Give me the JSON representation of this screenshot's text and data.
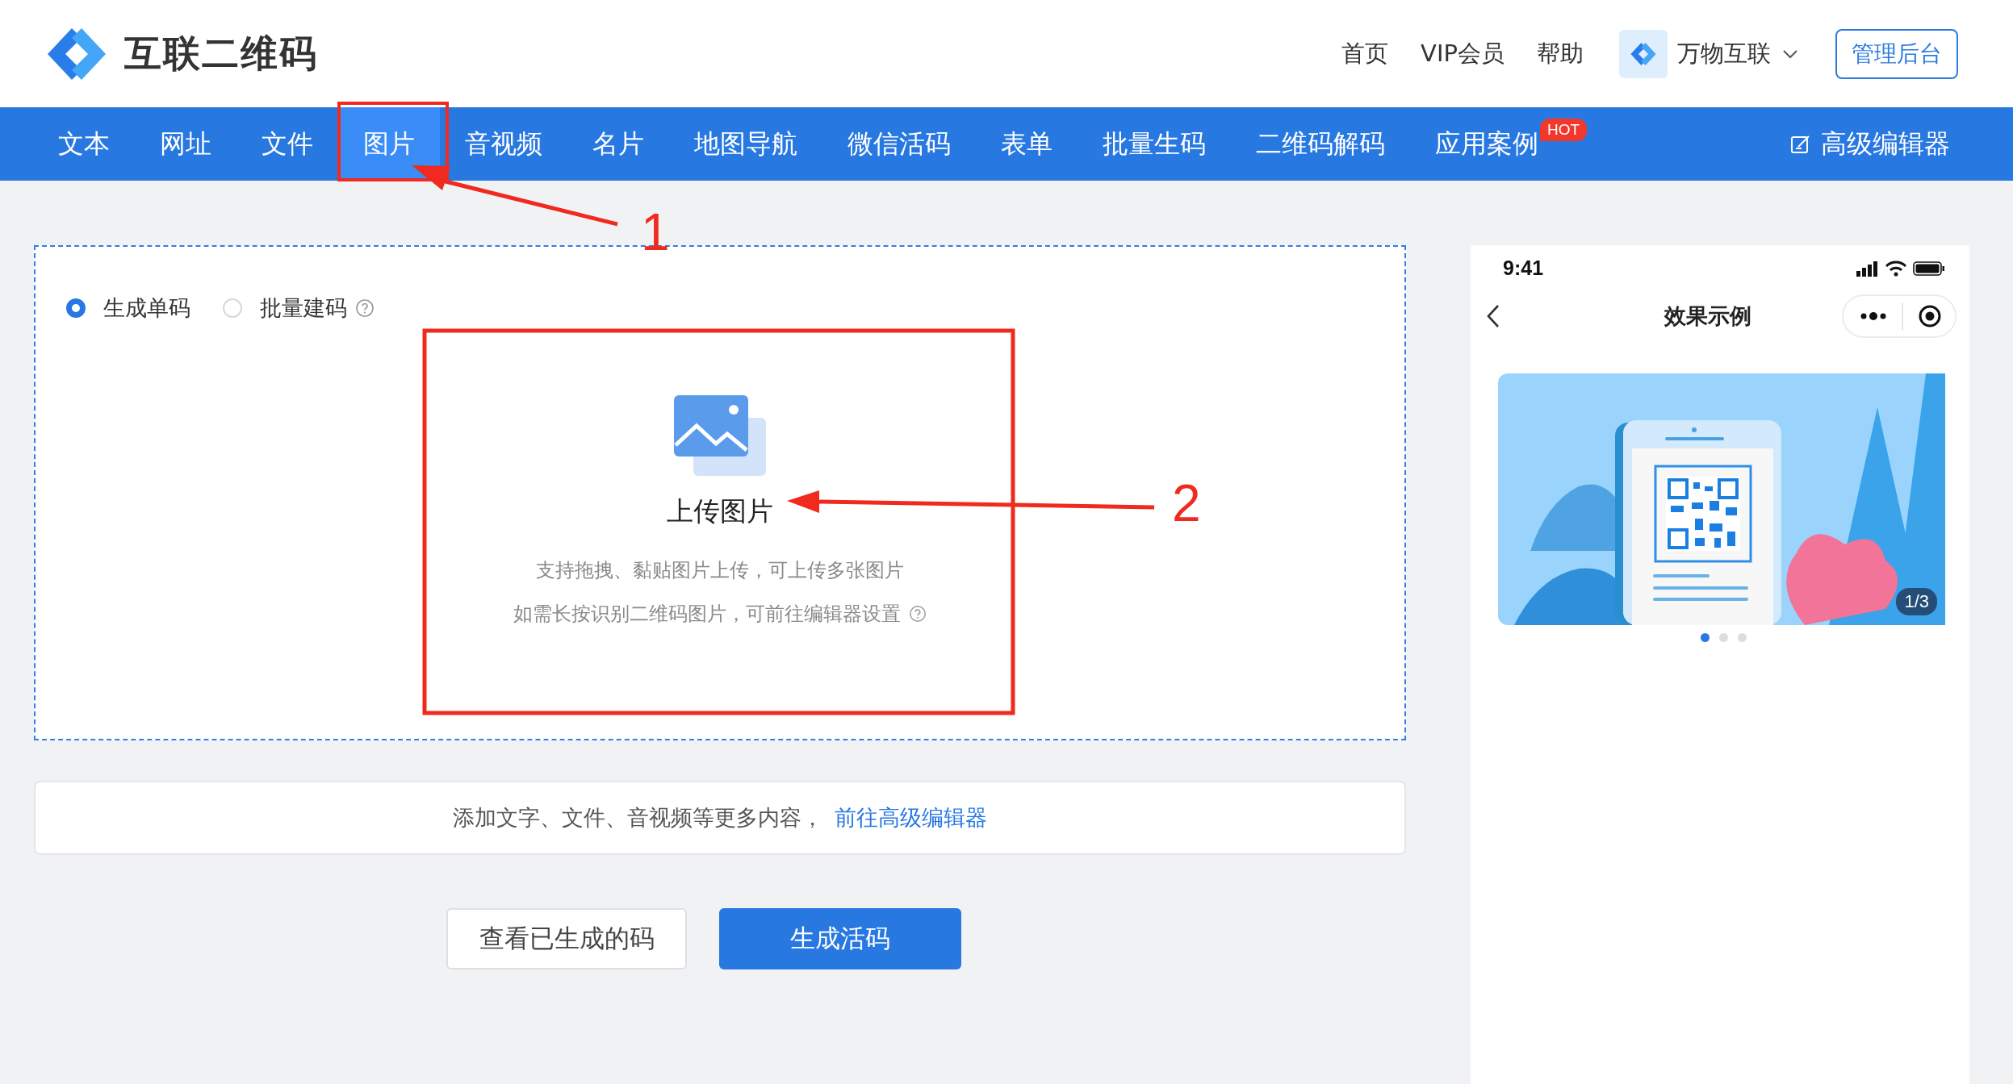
{
  "header": {
    "logo_text": "互联二维码",
    "links": [
      "首页",
      "VIP会员",
      "帮助"
    ],
    "org": "万物互联",
    "admin_button": "管理后台"
  },
  "nav": {
    "tabs": [
      {
        "label": "文本",
        "selected": false
      },
      {
        "label": "网址",
        "selected": false
      },
      {
        "label": "文件",
        "selected": false
      },
      {
        "label": "图片",
        "selected": true
      },
      {
        "label": "音视频",
        "selected": false
      },
      {
        "label": "名片",
        "selected": false
      },
      {
        "label": "地图导航",
        "selected": false
      },
      {
        "label": "微信活码",
        "selected": false
      },
      {
        "label": "表单",
        "selected": false
      },
      {
        "label": "批量生码",
        "selected": false
      },
      {
        "label": "二维码解码",
        "selected": false
      },
      {
        "label": "应用案例",
        "selected": false,
        "badge": "HOT"
      }
    ],
    "editor_link": "高级编辑器"
  },
  "mode": {
    "options": [
      {
        "label": "生成单码",
        "selected": true,
        "help": false
      },
      {
        "label": "批量建码",
        "selected": false,
        "help": true
      }
    ]
  },
  "upload": {
    "title": "上传图片",
    "hints": [
      {
        "text": "支持拖拽、黏贴图片上传，可上传多张图片",
        "help": false
      },
      {
        "text": "如需长按识别二维码图片，可前往编辑器设置",
        "help": true
      }
    ]
  },
  "more": {
    "text": "添加文字、文件、音视频等更多内容，",
    "link": "前往高级编辑器"
  },
  "buttons": [
    {
      "label": "查看已生成的码",
      "kind": "secondary"
    },
    {
      "label": "生成活码",
      "kind": "primary"
    }
  ],
  "preview": {
    "time": "9:41",
    "title": "效果示例",
    "counter": "1/3",
    "dots": [
      {
        "selected": true
      },
      {
        "selected": false
      },
      {
        "selected": false
      }
    ]
  },
  "annotations": [
    {
      "number": "1"
    },
    {
      "number": "2"
    }
  ]
}
